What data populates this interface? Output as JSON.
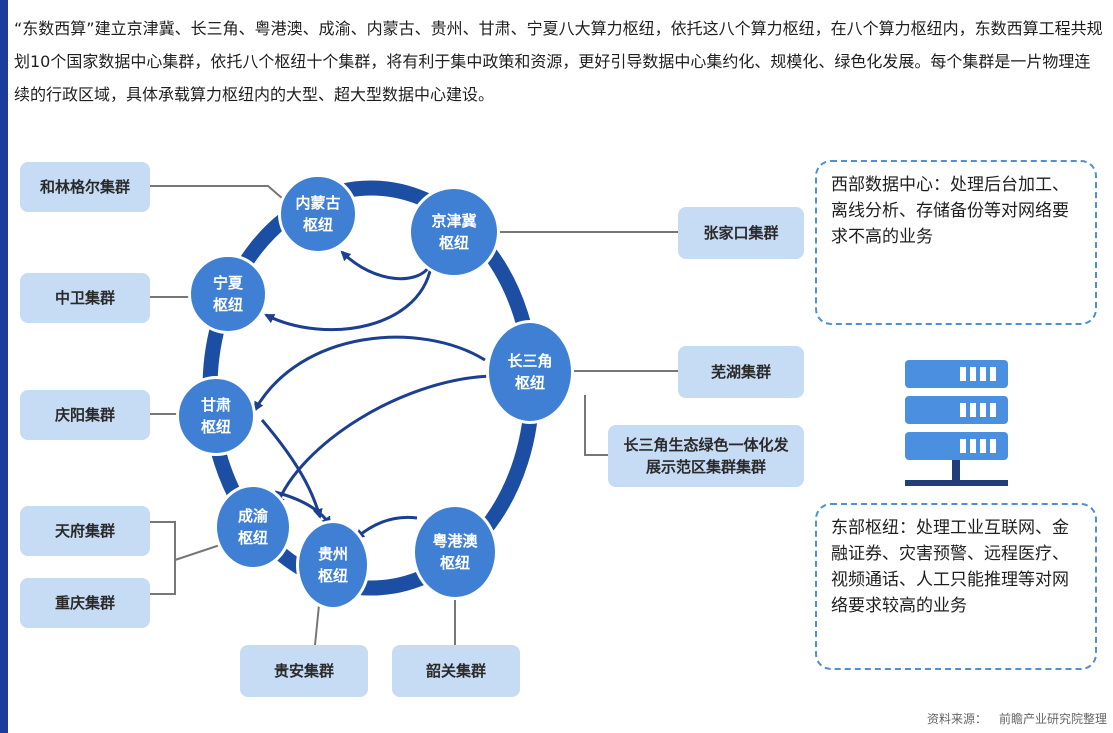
{
  "intro_text": "“东数西算”建立京津冀、长三角、粤港澳、成渝、内蒙古、贵州、甘肃、宁夏八大算力枢纽，依托这八个算力枢纽，在八个算力枢纽内，东数西算工程共规划10个国家数据中心集群，依托八个枢纽十个集群，将有利于集中政策和资源，更好引导数据中心集约化、规模化、绿色化发展。每个集群是一片物理连续的行政区域，具体承载算力枢纽内的大型、超大型数据中心建设。",
  "hubs": {
    "neimenggu": "内蒙古\n枢纽",
    "jingjinji": "京津冀\n枢纽",
    "ningxia": "宁夏\n枢纽",
    "changsanjiao": "长三角\n枢纽",
    "gansu": "甘肃\n枢纽",
    "chengyu": "成渝\n枢纽",
    "guizhou": "贵州\n枢纽",
    "yuegangao": "粤港澳\n枢纽"
  },
  "clusters": {
    "helingeer": "和林格尔集群",
    "zhongwei": "中卫集群",
    "qingyang": "庆阳集群",
    "tianfu": "天府集群",
    "chongqing": "重庆集群",
    "guian": "贵安集群",
    "shaoguan": "韶关集群",
    "zhangjiakou": "张家口集群",
    "wuhu": "芜湖集群",
    "changsanjiao_demo": "长三角生态绿色一体化发展示范区集群集群"
  },
  "cards": {
    "west": "西部数据中心：处理后台加工、离线分析、存储备份等对网络要求不高的业务",
    "east": "东部枢纽：处理工业互联网、金融证券、灾害预警、远程医疗、视频通话、人工只能推理等对网络要求较高的业务"
  },
  "source": {
    "label": "资料来源：",
    "value": "前瞻产业研究院整理"
  },
  "colors": {
    "ring": "#1c4fa3",
    "hub": "#3f80d4",
    "arrow": "#1c3f91",
    "box": "#c6dbf4",
    "server": "#4a8fe0",
    "card_border": "#4f8fd6"
  },
  "icons": [
    "server-icon"
  ]
}
